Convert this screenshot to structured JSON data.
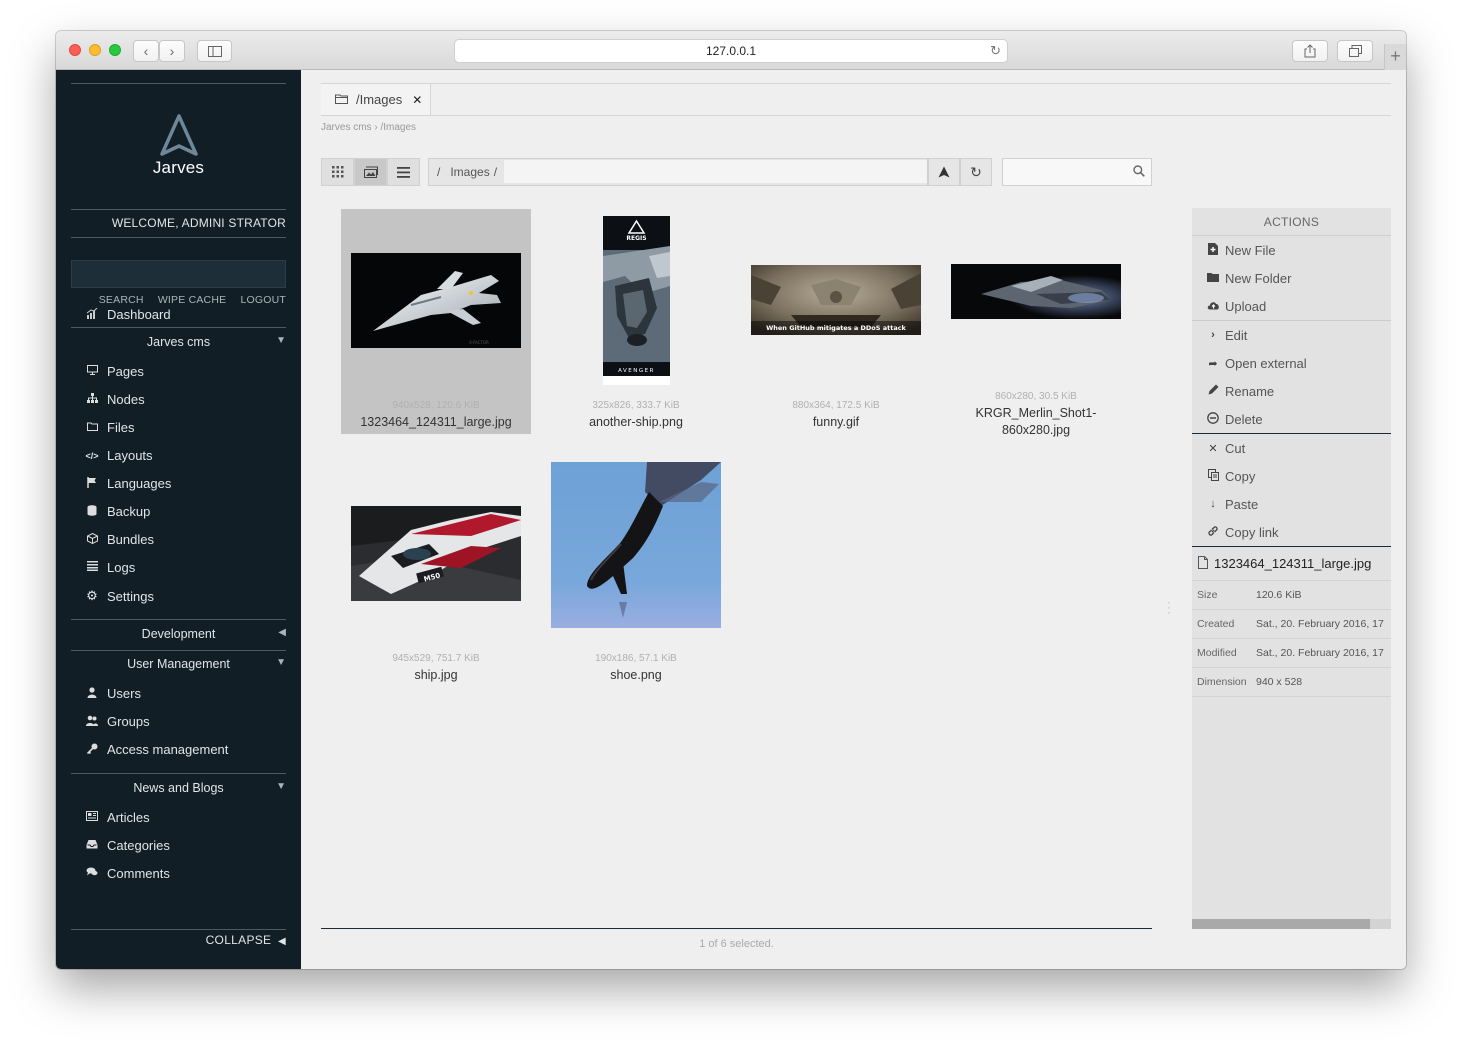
{
  "browser": {
    "url": "127.0.0.1"
  },
  "sidebar": {
    "brand": "Jarves",
    "welcome": "WELCOME, ADMINI STRATOR",
    "links": [
      "SEARCH",
      "WIPE CACHE",
      "LOGOUT"
    ],
    "dashboard": "Dashboard",
    "sections": [
      {
        "title": "Jarves cms",
        "expanded": true,
        "items": [
          "Pages",
          "Nodes",
          "Files",
          "Layouts",
          "Languages",
          "Backup",
          "Bundles",
          "Logs",
          "Settings"
        ]
      },
      {
        "title": "Development",
        "expanded": false,
        "items": []
      },
      {
        "title": "User Management",
        "expanded": true,
        "items": [
          "Users",
          "Groups",
          "Access management"
        ]
      },
      {
        "title": "News and Blogs",
        "expanded": true,
        "items": [
          "Articles",
          "Categories",
          "Comments"
        ]
      }
    ],
    "collapse": "COLLAPSE"
  },
  "tab": {
    "label": "/Images"
  },
  "breadcrumb": {
    "root": "Jarves cms",
    "sep": "›",
    "current": "/Images"
  },
  "toolbar": {
    "path": [
      "/",
      "Images",
      "/"
    ]
  },
  "files": [
    {
      "name": "1323464_124311_large.jpg",
      "meta": "940x528, 120.6 KiB",
      "selected": true
    },
    {
      "name": "another-ship.png",
      "meta": "325x826, 333.7 KiB",
      "selected": false
    },
    {
      "name": "funny.gif",
      "meta": "880x364, 172.5 KiB",
      "selected": false,
      "caption": "When GitHub mitigates a DDoS attack"
    },
    {
      "name": "KRGR_Merlin_Shot1-860x280.jpg",
      "name_line1": "KRGR_Merlin_Shot1-",
      "name_line2": "860x280.jpg",
      "meta": "860x280, 30.5 KiB",
      "selected": false
    },
    {
      "name": "ship.jpg",
      "meta": "945x529, 751.7 KiB",
      "selected": false
    },
    {
      "name": "shoe.png",
      "meta": "190x186, 57.1 KiB",
      "selected": false
    }
  ],
  "poster": {
    "brand": "REGIS",
    "title": "AVENGER"
  },
  "status": "1 of 6 selected.",
  "actions": {
    "title": "ACTIONS",
    "group1": [
      "New File",
      "New Folder",
      "Upload"
    ],
    "group2": [
      "Edit",
      "Open external",
      "Rename",
      "Delete"
    ],
    "group3": [
      "Cut",
      "Copy",
      "Paste",
      "Copy link"
    ]
  },
  "info": {
    "name": "1323464_124311_large.jpg",
    "rows": [
      {
        "k": "Size",
        "v": "120.6 KiB"
      },
      {
        "k": "Created",
        "v": "Sat., 20. February 2016, 17"
      },
      {
        "k": "Modified",
        "v": "Sat., 20. February 2016, 17"
      },
      {
        "k": "Dimension",
        "v": "940 x 528"
      }
    ]
  }
}
